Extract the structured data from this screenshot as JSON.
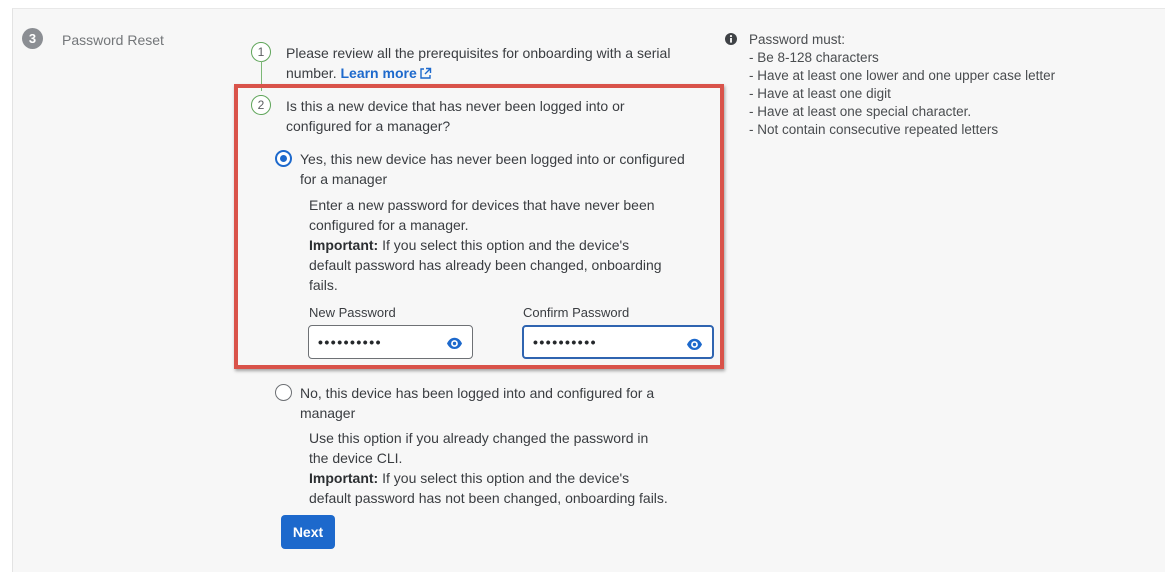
{
  "step": {
    "number": "3",
    "title": "Password Reset"
  },
  "prereq": {
    "number": "1",
    "line1": "Please review all the prerequisites for onboarding with a serial",
    "line2": "number.",
    "link_label": "Learn more"
  },
  "question": {
    "number": "2",
    "line1": "Is this a new device that has never been logged into or",
    "line2": "configured for a manager?"
  },
  "option_yes": {
    "label_line1": "Yes, this new device has never been logged into or configured",
    "label_line2": "for a manager",
    "desc_line1": "Enter a new password for devices that have never been",
    "desc_line2": "configured for a manager.",
    "important_label": "Important:",
    "important_line1": " If you select this option and the device's",
    "important_line2": "default password has already been changed, onboarding",
    "important_line3": "fails.",
    "selected": true
  },
  "new_password": {
    "label": "New Password",
    "masked_value": "••••••••••"
  },
  "confirm_password": {
    "label": "Confirm Password",
    "masked_value": "••••••••••"
  },
  "option_no": {
    "label_line1": "No, this device has been logged into and configured for a",
    "label_line2": "manager",
    "desc_line1": "Use this option if you already changed the password in",
    "desc_line2": "the device CLI.",
    "important_label": "Important:",
    "important_line1": " If you select this option and the device's",
    "important_line2": "default password has not been changed, onboarding fails.",
    "selected": false
  },
  "next_button": {
    "label": "Next"
  },
  "password_rules": {
    "heading": "Password must:",
    "items": [
      "- Be 8-128 characters",
      "- Have at least one lower and one upper case letter",
      "- Have at least one digit",
      "- Have at least one special character.",
      "- Not contain consecutive repeated letters"
    ]
  },
  "colors": {
    "accent": "#1d69cc",
    "highlight_border": "#d9534a",
    "step_complete": "#5fa55a"
  },
  "icons": [
    "external-link-icon",
    "info-icon",
    "eye-icon"
  ]
}
